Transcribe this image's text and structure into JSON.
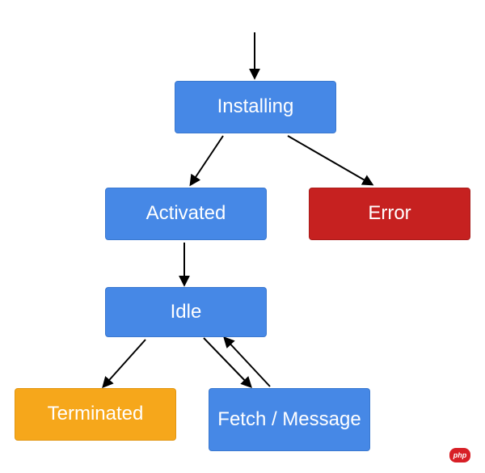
{
  "nodes": {
    "installing": "Installing",
    "activated": "Activated",
    "error": "Error",
    "idle": "Idle",
    "terminated": "Terminated",
    "fetch": "Fetch / Message"
  },
  "badge": "php",
  "colors": {
    "blue": "#4688e6",
    "red": "#c62120",
    "orange": "#f6a71b"
  },
  "edges": [
    {
      "from": "entry",
      "to": "installing"
    },
    {
      "from": "installing",
      "to": "activated"
    },
    {
      "from": "installing",
      "to": "error"
    },
    {
      "from": "activated",
      "to": "idle"
    },
    {
      "from": "idle",
      "to": "terminated"
    },
    {
      "from": "idle",
      "to": "fetch",
      "bidirectional": true
    }
  ]
}
